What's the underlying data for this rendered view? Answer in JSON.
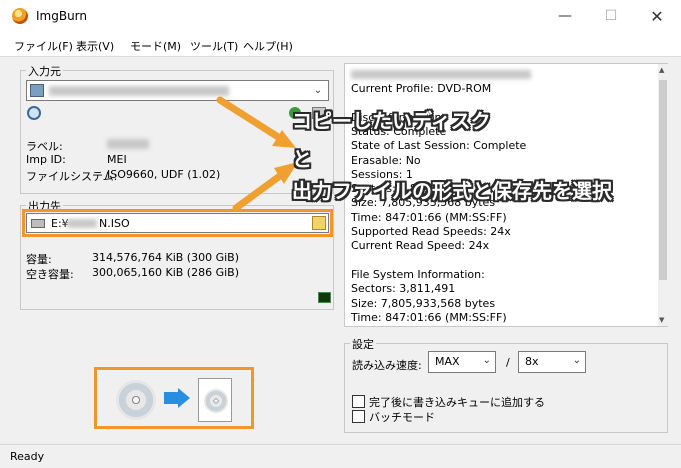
{
  "window": {
    "title": "ImgBurn",
    "min": "—",
    "max": "☐",
    "close": "✕"
  },
  "menu": [
    "ファイル(F)",
    "表示(V)",
    "モード(M)",
    "ツール(T)",
    "ヘルプ(H)"
  ],
  "source": {
    "group_label": "入力元",
    "rows": [
      {
        "label": "ラベル:",
        "value": ""
      },
      {
        "label": "Imp ID:",
        "value": "MEI"
      },
      {
        "label": "ファイルシステム:",
        "value": "ISO9660, UDF (1.02)"
      }
    ]
  },
  "destination": {
    "group_label": "出力先",
    "path_prefix": "E:¥",
    "path_suffix": "N.ISO",
    "capacity_label": "容量:",
    "capacity_value": "314,576,764 KiB  (300 GiB)",
    "free_label": "空き容量:",
    "free_value": "300,065,160 KiB  (286 GiB)"
  },
  "info": {
    "lines": [
      "Current Profile: DVD-ROM",
      "",
      "Disc Information:",
      "Status: Complete",
      "State of Last Session: Complete",
      "Erasable: No",
      "Sessions: 1",
      "Sectors: 3,811,491",
      "Size: 7,805,933,568 bytes",
      "Time: 847:01:66 (MM:SS:FF)",
      "Supported Read Speeds: 24x",
      "Current Read Speed: 24x",
      "",
      "File System Information:",
      "Sectors: 3,811,491",
      "Size: 7,805,933,568 bytes",
      "Time: 847:01:66 (MM:SS:FF)"
    ]
  },
  "settings": {
    "group_label": "設定",
    "read_speed_label": "読み込み速度:",
    "read_speed_value": "MAX",
    "separator": "/",
    "speed_value": "8x",
    "checkbox1_label": "完了後に書き込みキューに追加する",
    "checkbox2_label": "バッチモード"
  },
  "status": {
    "text": "Ready"
  },
  "annotations": {
    "line1": "コピーしたいディスク",
    "line2": "と",
    "line3": "出力ファイルの形式と保存先を選択"
  },
  "colors": {
    "accent": "#f0962a",
    "arrow": "#f0a030"
  }
}
